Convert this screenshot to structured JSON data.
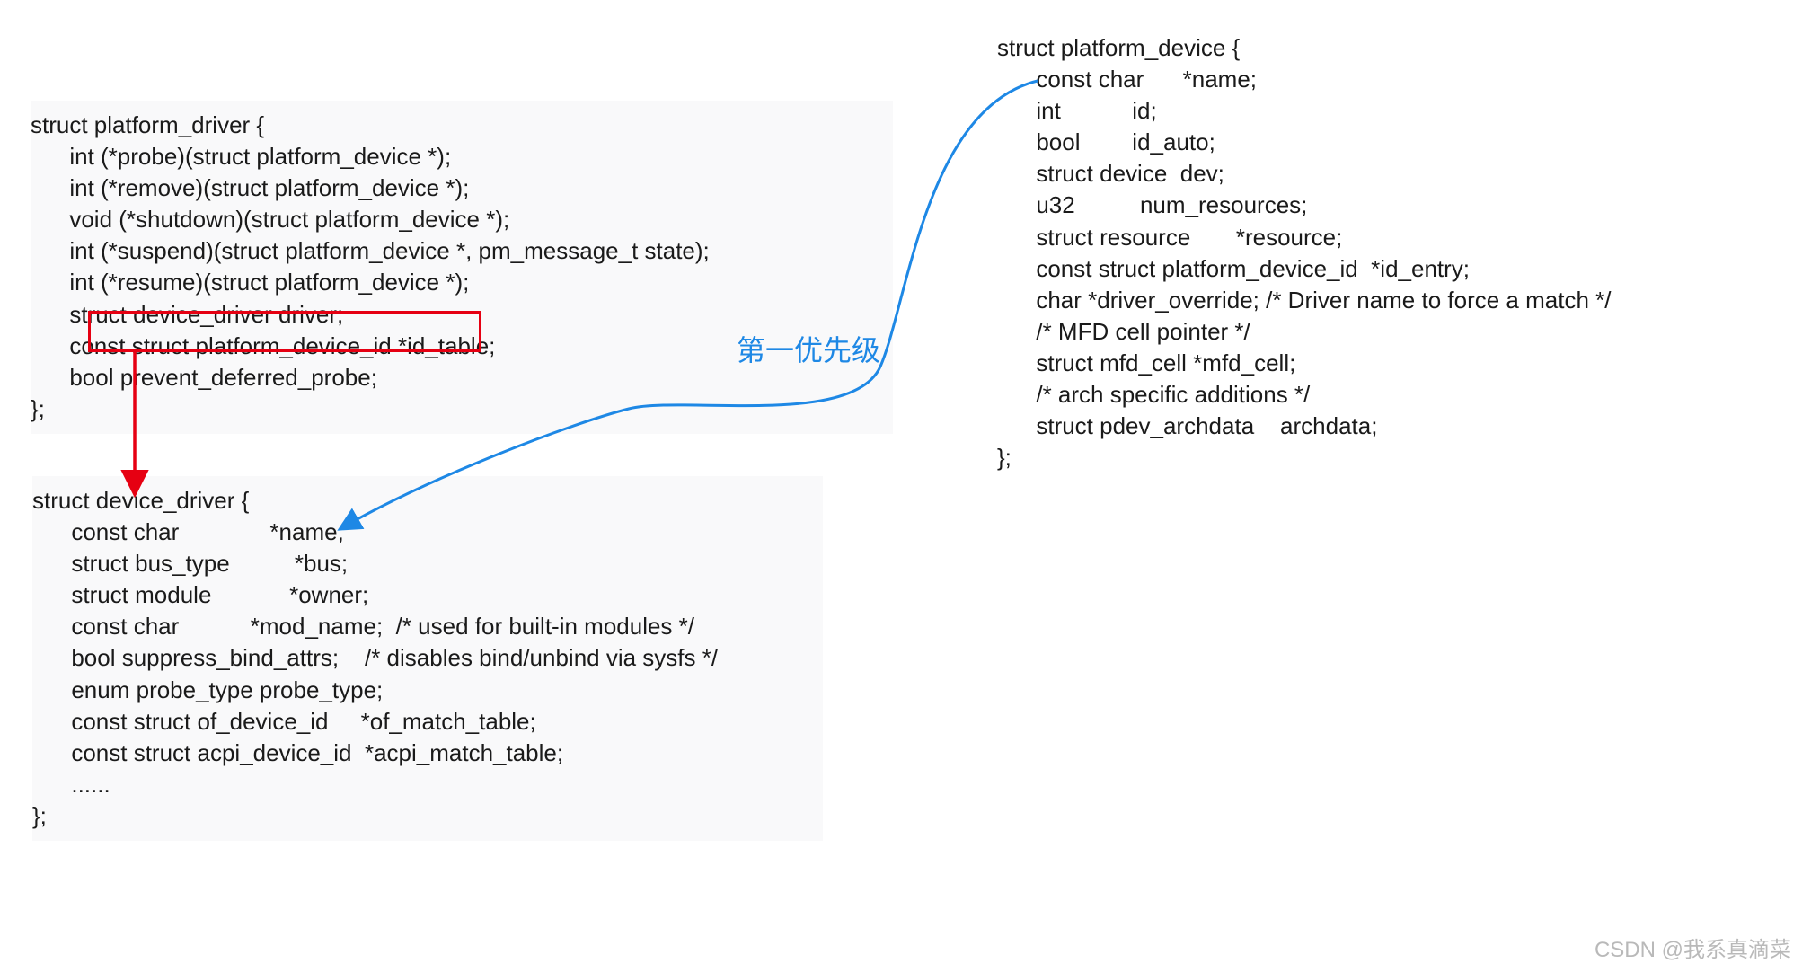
{
  "block_driver": {
    "lines": [
      "struct platform_driver {",
      "      int (*probe)(struct platform_device *);",
      "      int (*remove)(struct platform_device *);",
      "      void (*shutdown)(struct platform_device *);",
      "      int (*suspend)(struct platform_device *, pm_message_t state);",
      "      int (*resume)(struct platform_device *);",
      "      struct device_driver driver;",
      "      const struct platform_device_id *id_table;",
      "      bool prevent_deferred_probe;",
      "};"
    ]
  },
  "block_device_driver": {
    "lines": [
      "struct device_driver {",
      "      const char              *name;",
      "      struct bus_type          *bus;",
      "",
      "      struct module            *owner;",
      "      const char           *mod_name;  /* used for built-in modules */",
      "",
      "      bool suppress_bind_attrs;    /* disables bind/unbind via sysfs */",
      "      enum probe_type probe_type;",
      "",
      "      const struct of_device_id     *of_match_table;",
      "      const struct acpi_device_id  *acpi_match_table;",
      "",
      "      ......",
      "};"
    ]
  },
  "block_platform_device": {
    "lines": [
      "struct platform_device {",
      "      const char      *name;",
      "      int           id;",
      "      bool        id_auto;",
      "      struct device  dev;",
      "      u32          num_resources;",
      "      struct resource       *resource;",
      "",
      "      const struct platform_device_id  *id_entry;",
      "      char *driver_override; /* Driver name to force a match */",
      "",
      "      /* MFD cell pointer */",
      "      struct mfd_cell *mfd_cell;",
      "",
      "      /* arch specific additions */",
      "      struct pdev_archdata    archdata;",
      "};"
    ]
  },
  "annotation": {
    "priority_label": "第一优先级"
  },
  "watermark": "CSDN @我系真滴菜"
}
